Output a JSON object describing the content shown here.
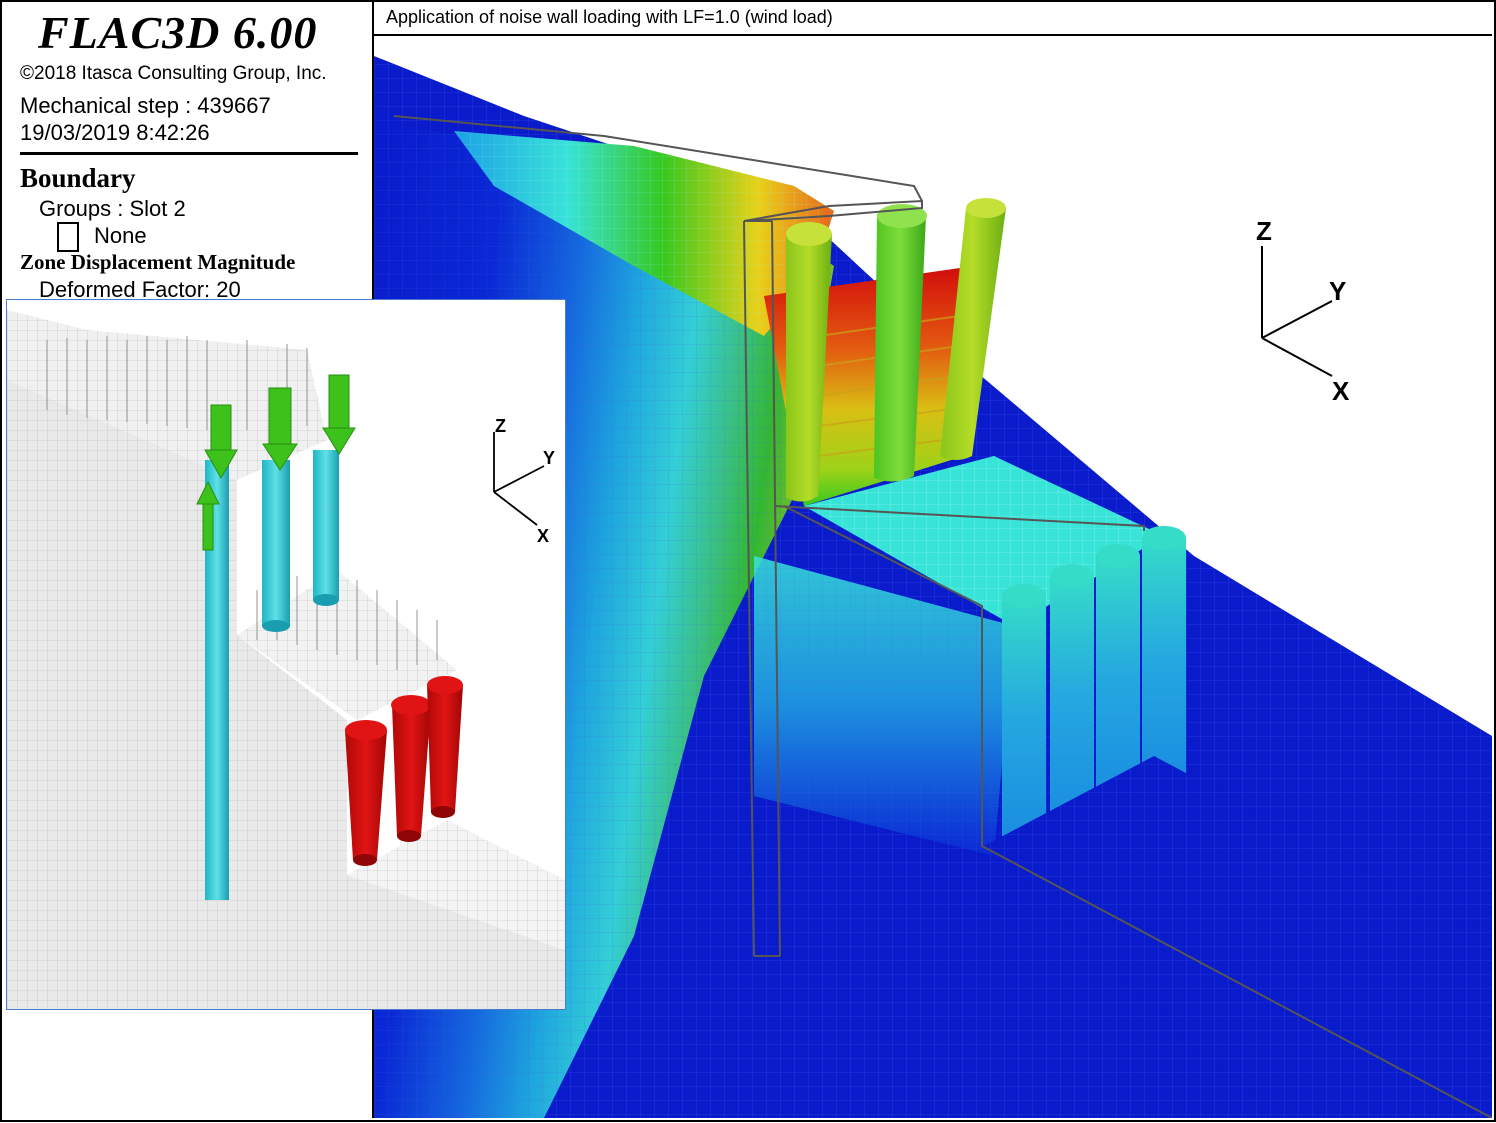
{
  "app": {
    "title": "FLAC3D 6.00",
    "copyright": "©2018 Itasca Consulting Group, Inc."
  },
  "status": {
    "mechanical_step": "Mechanical step : 439667",
    "datetime": "19/03/2019 8:42:26"
  },
  "legend": {
    "boundary_heading": "Boundary",
    "groups_label": "Groups : Slot 2",
    "none_label": "None",
    "zone_heading": "Zone Displacement Magnitude",
    "deformed_factor": "Deformed Factor: 20"
  },
  "plot": {
    "title": "Application of noise wall loading with LF=1.0 (wind load)"
  },
  "axes_main": {
    "z": "Z",
    "y": "Y",
    "x": "X"
  },
  "axes_inset": {
    "z": "Z",
    "y": "Y",
    "x": "X"
  },
  "colors": {
    "deep_blue": "#0a1bcc",
    "cyan": "#38e3d8",
    "green": "#37c81f",
    "yellow_green": "#a7d418",
    "red": "#d20c0c",
    "inset_border": "#4a7bd0",
    "pile_cyan": "#2ec7d6",
    "arrow_green": "#3cc21a",
    "mesh_grey": "#e6e6e6"
  },
  "icons": [
    "checkbox-icon",
    "axis-triad-icon"
  ]
}
